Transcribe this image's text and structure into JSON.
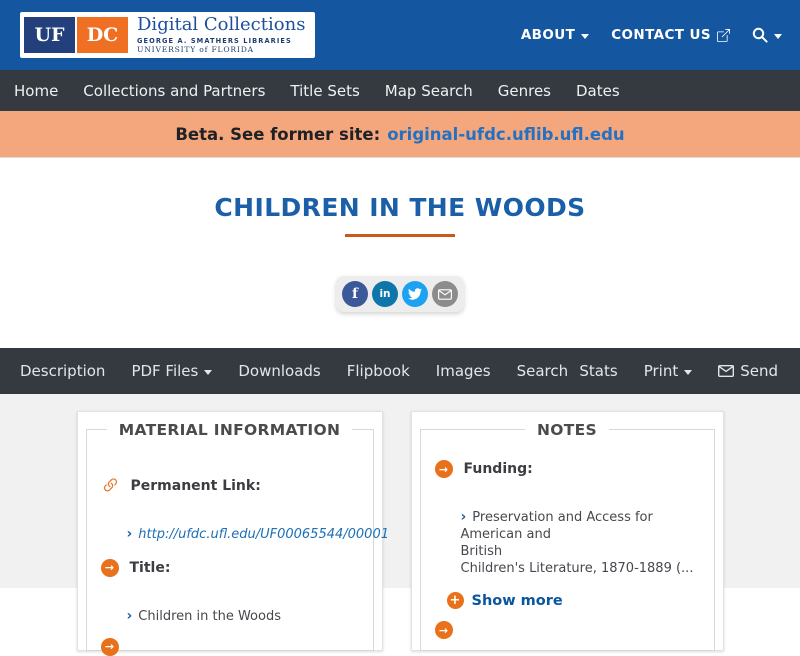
{
  "header": {
    "logo": {
      "uf": "UF",
      "dc": "DC",
      "title": "Digital Collections",
      "subtitle1": "GEORGE A. SMATHERS LIBRARIES",
      "subtitle2": "UNIVERSITY of FLORIDA"
    },
    "menu": {
      "about": "ABOUT",
      "contact": "CONTACT US"
    }
  },
  "nav": {
    "items": [
      "Home",
      "Collections and Partners",
      "Title Sets",
      "Map Search",
      "Genres",
      "Dates"
    ]
  },
  "beta_banner": {
    "text": "Beta. See former site:",
    "link": "original-ufdc.uflib.ufl.edu"
  },
  "item": {
    "title": "CHILDREN IN THE WOODS"
  },
  "social": {
    "facebook": "f",
    "linkedin": "in"
  },
  "toolbar": {
    "left": [
      "Description",
      "PDF Files",
      "Downloads",
      "Flipbook",
      "Images",
      "Search"
    ],
    "right": [
      "Stats",
      "Print",
      "Send"
    ]
  },
  "material_info": {
    "legend": "MATERIAL INFORMATION",
    "fields": [
      {
        "label": "Permanent Link:",
        "value": "http://ufdc.ufl.edu/UF00065544/00001"
      },
      {
        "label": "Title:",
        "value": "Children in the Woods"
      }
    ]
  },
  "notes": {
    "legend": "NOTES",
    "fields": [
      {
        "label": "Funding:",
        "value": "Preservation and Access for American and\nBritish\nChildren's Literature, 1870-1889 (..."
      }
    ],
    "show_more": "Show more"
  },
  "glyphs": {
    "chevron": "›",
    "arrow": "→",
    "plus": "+"
  },
  "colors": {
    "header_blue": "#1456a0",
    "nav_dark": "#343a40",
    "banner_peach": "#f4a77c",
    "title_blue": "#1b5fa8",
    "accent_orange": "#e8711a",
    "rule_orange": "#c75b1c",
    "link_blue": "#2470c2",
    "facebook": "#3b5998",
    "linkedin": "#0e76a8",
    "twitter": "#1da1f2",
    "email_gray": "#8c8c8c"
  }
}
